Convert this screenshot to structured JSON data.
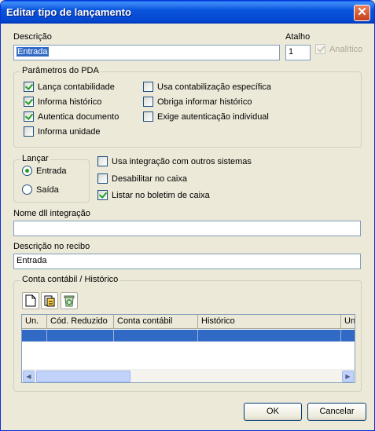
{
  "window": {
    "title": "Editar tipo de lançamento",
    "close_label": "✕"
  },
  "descricao": {
    "label": "Descrição",
    "value": "Entrada"
  },
  "atalho": {
    "label": "Atalho",
    "value": "1"
  },
  "analitico": {
    "label": "Analítico",
    "checked": true,
    "disabled": true
  },
  "pda": {
    "legend": "Parâmetros do PDA",
    "options": [
      {
        "label": "Lança contabilidade",
        "checked": true
      },
      {
        "label": "Informa histórico",
        "checked": true
      },
      {
        "label": "Autentica documento",
        "checked": true
      },
      {
        "label": "Informa unidade",
        "checked": false
      },
      {
        "label": "Usa contabilização específica",
        "checked": false
      },
      {
        "label": "Obriga informar histórico",
        "checked": false
      },
      {
        "label": "Exige autenticação individual",
        "checked": false
      }
    ]
  },
  "lancar": {
    "legend": "Lançar",
    "options": [
      {
        "label": "Entrada",
        "checked": true
      },
      {
        "label": "Saída",
        "checked": false
      }
    ]
  },
  "options2": [
    {
      "label": "Usa integração com outros sistemas",
      "checked": false
    },
    {
      "label": "Desabilitar no caixa",
      "checked": false
    },
    {
      "label": "Listar no boletim de caixa",
      "checked": true
    }
  ],
  "nome_dll": {
    "label": "Nome dll integração",
    "value": ""
  },
  "descricao_recibo": {
    "label": "Descrição no recibo",
    "value": "Entrada"
  },
  "conta": {
    "legend": "Conta contábil / Histórico",
    "toolbar": [
      "new-document-icon",
      "edit-icon",
      "recycle-bin-icon"
    ],
    "columns": [
      "Un.",
      "Cód. Reduzido",
      "Conta contábil",
      "Histórico",
      "Un"
    ],
    "rows": [
      [
        "",
        "",
        "",
        "",
        ""
      ]
    ]
  },
  "buttons": {
    "ok": "OK",
    "cancel": "Cancelar"
  }
}
